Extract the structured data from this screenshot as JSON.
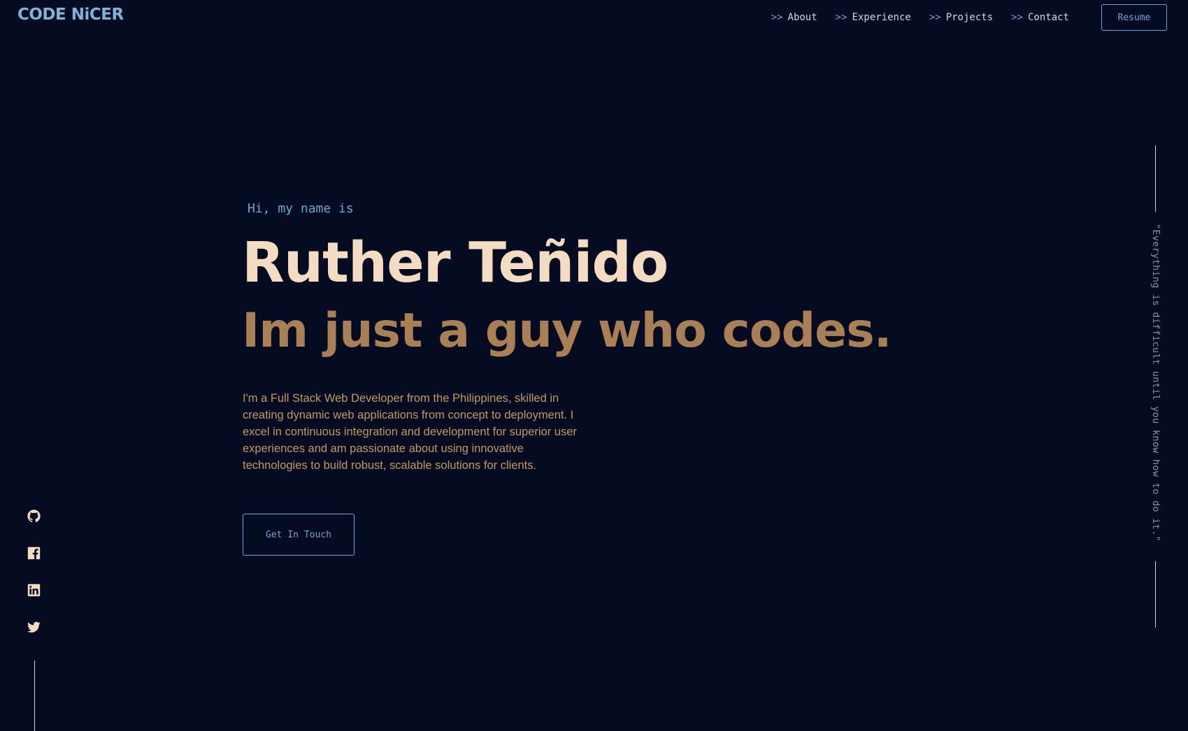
{
  "header": {
    "logo": "CODE NiCER",
    "nav": [
      {
        "prefix": ">>",
        "label": "About"
      },
      {
        "prefix": ">>",
        "label": "Experience"
      },
      {
        "prefix": ">>",
        "label": "Projects"
      },
      {
        "prefix": ">>",
        "label": "Contact"
      }
    ],
    "resume_label": "Resume"
  },
  "hero": {
    "greeting": "Hi, my name is",
    "name": "Ruther Teñido",
    "tagline": "Im just a guy who codes.",
    "bio": "I'm a Full Stack Web Developer from the Philippines, skilled in creating dynamic web applications from concept to deployment. I excel in continuous integration and development for superior user experiences and am passionate about using innovative technologies to build robust, scalable solutions for clients.",
    "cta_label": "Get In Touch"
  },
  "socials": [
    {
      "icon": "github-icon"
    },
    {
      "icon": "facebook-icon"
    },
    {
      "icon": "linkedin-icon"
    },
    {
      "icon": "twitter-icon"
    }
  ],
  "quote": "\"Everything is difficult until you know how to do it.\"",
  "colors": {
    "background": "#050b20",
    "accent": "#6aa7d6",
    "name": "#f3dcc2",
    "tagline": "#a98055",
    "bio": "#c59862"
  }
}
